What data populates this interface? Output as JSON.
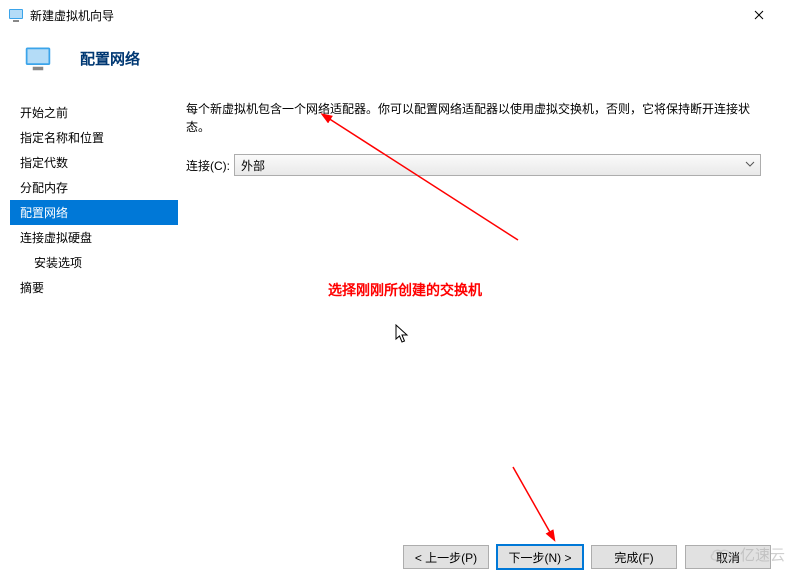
{
  "window": {
    "title": "新建虚拟机向导",
    "close_aria": "close"
  },
  "header": {
    "title": "配置网络"
  },
  "nav": {
    "items": [
      {
        "label": "开始之前"
      },
      {
        "label": "指定名称和位置"
      },
      {
        "label": "指定代数"
      },
      {
        "label": "分配内存"
      },
      {
        "label": "配置网络",
        "selected": true
      },
      {
        "label": "连接虚拟硬盘"
      },
      {
        "label": "安装选项",
        "indent": true
      },
      {
        "label": "摘要"
      }
    ]
  },
  "main": {
    "description": "每个新虚拟机包含一个网络适配器。你可以配置网络适配器以使用虚拟交换机，否则，它将保持断开连接状态。",
    "connection_label": "连接(C):",
    "connection_value": "外部"
  },
  "annotation": {
    "text": "选择刚刚所创建的交换机"
  },
  "footer": {
    "prev": "< 上一步(P)",
    "next": "下一步(N) >",
    "finish": "完成(F)",
    "cancel": "取消"
  },
  "watermark": "亿速云"
}
